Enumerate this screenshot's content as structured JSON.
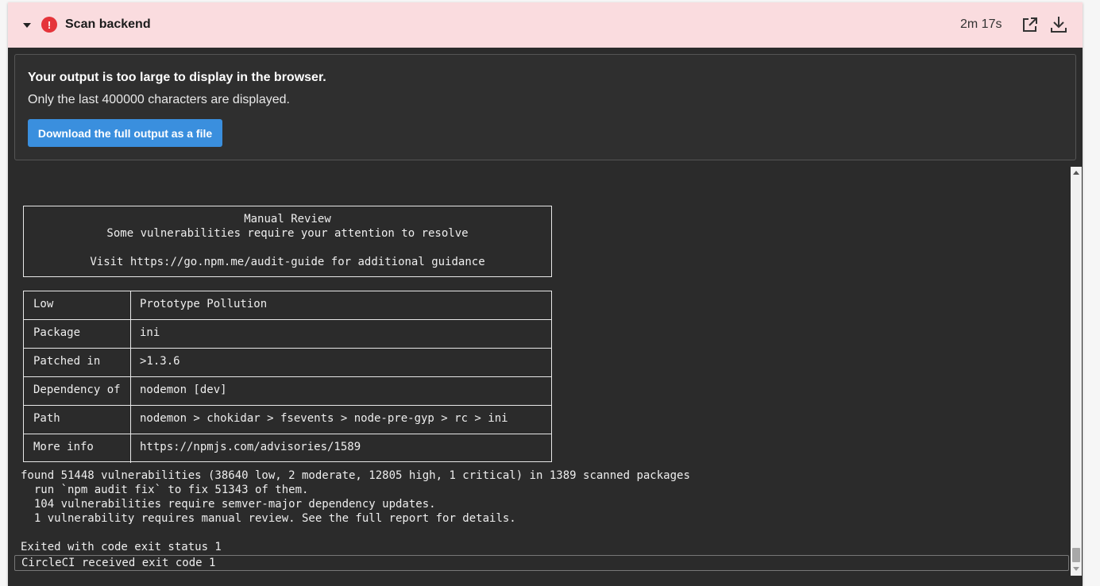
{
  "step": {
    "title": "Scan backend",
    "status_icon": "error-icon",
    "status_glyph": "!",
    "duration": "2m 17s",
    "status_color": "#e5343a",
    "header_bg": "#fadcdf"
  },
  "notice": {
    "title": "Your output is too large to display in the browser.",
    "text": "Only the last 400000 characters are displayed.",
    "download_label": "Download the full output as a file",
    "button_color": "#3a8fde"
  },
  "manual_review": {
    "lines": [
      "Manual Review",
      "Some vulnerabilities require your attention to resolve",
      "",
      "Visit https://go.npm.me/audit-guide for additional guidance"
    ]
  },
  "advisory": [
    {
      "key": "Low",
      "value": "Prototype Pollution"
    },
    {
      "key": "Package",
      "value": "ini"
    },
    {
      "key": "Patched in",
      "value": ">1.3.6"
    },
    {
      "key": "Dependency of",
      "value": "nodemon [dev]"
    },
    {
      "key": "Path",
      "value": "nodemon > chokidar > fsevents > node-pre-gyp > rc > ini"
    },
    {
      "key": "More info",
      "value": "https://npmjs.com/advisories/1589"
    }
  ],
  "output_lines": [
    "found 51448 vulnerabilities (38640 low, 2 moderate, 12805 high, 1 critical) in 1389 scanned packages",
    "  run `npm audit fix` to fix 51343 of them.",
    "  104 vulnerabilities require semver-major dependency updates.",
    "  1 vulnerability requires manual review. See the full report for details.",
    "",
    "Exited with code exit status 1"
  ],
  "final_line": "CircleCI received exit code 1"
}
